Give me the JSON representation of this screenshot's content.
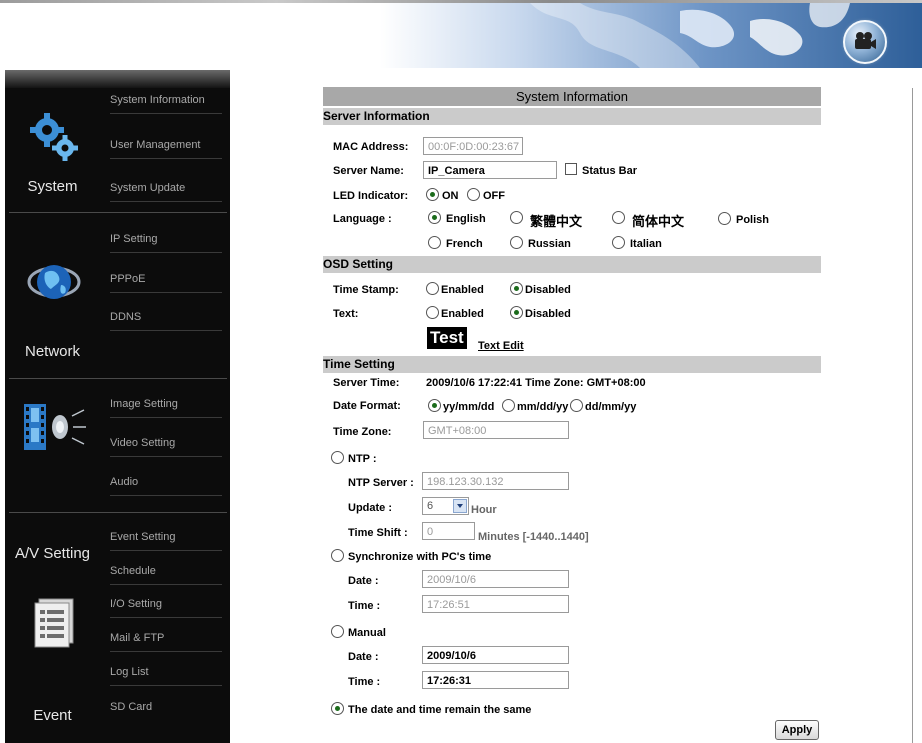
{
  "sidebar": {
    "groups": [
      {
        "label": "System",
        "icon": "gears-icon",
        "items": [
          "System Information",
          "User Management",
          "System Update"
        ]
      },
      {
        "label": "Network",
        "icon": "globe-icon",
        "items": [
          "IP Setting",
          "PPPoE",
          "DDNS"
        ]
      },
      {
        "label": "A/V Setting",
        "icon": "film-speaker-icon",
        "items": [
          "Image Setting",
          "Video Setting",
          "Audio"
        ]
      },
      {
        "label": "Event",
        "icon": "document-list-icon",
        "items": [
          "Event Setting",
          "Schedule",
          "I/O Setting",
          "Mail & FTP",
          "Log List",
          "SD Card"
        ]
      }
    ]
  },
  "main": {
    "title": "System Information",
    "server_info": {
      "header": "Server Information",
      "mac_label": "MAC Address:",
      "mac_value": "00:0F:0D:00:23:67",
      "name_label": "Server Name:",
      "name_value": "IP_Camera",
      "status_bar_label": "Status Bar",
      "led_label": "LED Indicator:",
      "led_on": "ON",
      "led_off": "OFF",
      "language_label": "Language :",
      "languages": [
        "English",
        "繁體中文",
        "简体中文",
        "Polish",
        "French",
        "Russian",
        "Italian"
      ],
      "selected_language": "English"
    },
    "osd": {
      "header": "OSD Setting",
      "timestamp_label": "Time Stamp:",
      "text_label": "Text:",
      "enabled": "Enabled",
      "disabled": "Disabled",
      "test_text": "Test",
      "text_edit": "Text Edit"
    },
    "time": {
      "header": "Time Setting",
      "server_time_label": "Server Time:",
      "server_time_value": "2009/10/6 17:22:41 Time Zone: GMT+08:00",
      "date_format_label": "Date Format:",
      "formats": [
        "yy/mm/dd",
        "mm/dd/yy",
        "dd/mm/yy"
      ],
      "timezone_label": "Time Zone:",
      "timezone_value": "GMT+08:00",
      "ntp_label": "NTP :",
      "ntp_server_label": "NTP Server :",
      "ntp_server_value": "198.123.30.132",
      "update_label": "Update :",
      "update_value": "6",
      "hour_unit": "Hour",
      "time_shift_label": "Time Shift :",
      "time_shift_value": "0",
      "time_shift_unit": "Minutes [-1440..1440]",
      "sync_label": "Synchronize with PC's time",
      "sync_date_label": "Date :",
      "sync_date_value": "2009/10/6",
      "sync_time_label": "Time :",
      "sync_time_value": "17:26:51",
      "manual_label": "Manual",
      "manual_date_label": "Date :",
      "manual_date_value": "2009/10/6",
      "manual_time_label": "Time :",
      "manual_time_value": "17:26:31",
      "remain_label": "The date and time remain the same",
      "apply": "Apply"
    }
  }
}
